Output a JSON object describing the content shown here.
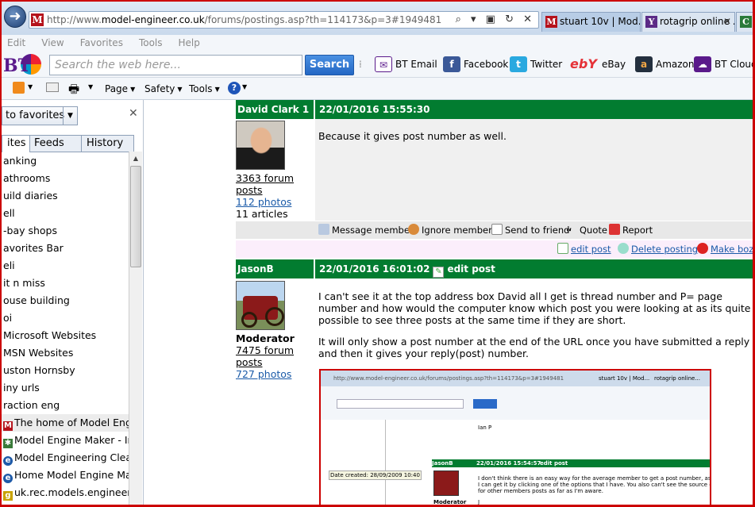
{
  "browser": {
    "address_prefix": "http://www.",
    "address_domain": "model-engineer.co.uk",
    "address_path": "/forums/postings.asp?th=114173&p=3#1949481",
    "address_tools": "⌕ ▾ ▣ ↻ ✕",
    "tabs": [
      {
        "label": "stuart 10v | Mod...",
        "icon": "M",
        "color": "#b5121b"
      },
      {
        "label": "rotagrip online ...",
        "icon": "Y",
        "color": "#5b2a86"
      },
      {
        "label": "C",
        "icon": "C",
        "color": "#2a7a3a"
      }
    ],
    "tab_close": "✕"
  },
  "menu": [
    "Edit",
    "View",
    "Favorites",
    "Tools",
    "Help"
  ],
  "bt_toolbar": {
    "logo": "BT",
    "search_placeholder": "Search the web here...",
    "search_button": "Search",
    "links": [
      {
        "label": "BT Email",
        "icon": "✉",
        "color": "#5a1a8b"
      },
      {
        "label": "Facebook",
        "icon": "f",
        "color": "#3b5998"
      },
      {
        "label": "Twitter",
        "icon": "t",
        "color": "#2aa9e0"
      },
      {
        "label": "eBay",
        "icon": "e",
        "color": "#e53238"
      },
      {
        "label": "Amazon",
        "icon": "a",
        "color": "#f3a847"
      },
      {
        "label": "BT Cloud",
        "icon": "☁",
        "color": "#5a1a8b"
      }
    ]
  },
  "command_bar": {
    "page": "Page",
    "safety": "Safety",
    "tools": "Tools",
    "help_icon": "?"
  },
  "favorites": {
    "add_button": "to favorites",
    "close": "✕",
    "tabs": [
      "ites",
      "Feeds",
      "History"
    ],
    "items": [
      {
        "label": "anking"
      },
      {
        "label": "athrooms"
      },
      {
        "label": "uild diaries"
      },
      {
        "label": "ell"
      },
      {
        "label": "-bay shops"
      },
      {
        "label": "avorites Bar"
      },
      {
        "label": "eli"
      },
      {
        "label": "it n miss"
      },
      {
        "label": "ouse building"
      },
      {
        "label": "oi"
      },
      {
        "label": "Microsoft Websites"
      },
      {
        "label": "MSN Websites"
      },
      {
        "label": "uston Hornsby"
      },
      {
        "label": "iny urls"
      },
      {
        "label": "raction eng"
      },
      {
        "label": "The home of Model Engi...",
        "icon": "M",
        "color": "#b5121b",
        "highlight": true
      },
      {
        "label": "Model Engine Maker - In...",
        "icon": "✱",
        "color": "#3a7a3a"
      },
      {
        "label": "Model Engineering Clear...",
        "icon": "e",
        "color": "#1e5aa8"
      },
      {
        "label": "Home Model Engine Ma...",
        "icon": "e",
        "color": "#1e5aa8"
      },
      {
        "label": "uk.rec.models.engineering",
        "icon": "g",
        "color": "#c8a200"
      }
    ]
  },
  "posts": [
    {
      "author": "David Clark 1",
      "datetime": "22/01/2016 15:55:30",
      "edit": "",
      "posts_count": "3363 forum posts",
      "photos": "112 photos",
      "articles": "11 articles",
      "role": "",
      "body": [
        "Because it gives post number as well."
      ],
      "actions": [
        "Message member",
        "Ignore member",
        "Send to friend",
        "Quote",
        "Report"
      ],
      "mod_actions": [
        "edit post",
        "Delete posting",
        "Make bozo"
      ]
    },
    {
      "author": "JasonB",
      "datetime": "22/01/2016 16:01:02",
      "edit": "edit post",
      "role": "Moderator",
      "posts_count": "7475 forum posts",
      "photos": "727 photos",
      "articles": "",
      "body": [
        "I can't see it at the top address box David all I get is thread number and P= page number and how would the computer know which post you were looking at as its quite possible to see three posts at the same time if they are short.",
        "It will only show a post number at the end of the URL once you have submitted a reply and then it gives your reply(post) number."
      ]
    }
  ],
  "embedded_shot": {
    "url": "http://www.model-engineer.co.uk/forums/postings.asp?th=114173&p=3#1949481",
    "tab1": "stuart 10v | Mod...",
    "tab2": "rotagrip online...",
    "author": "JasonB",
    "datetime": "22/01/2016 15:54:57",
    "edit": "edit post",
    "role": "Moderator",
    "sig": "Ian P",
    "tooltip": "Date created: 28/09/2009 10:40",
    "line1": "I don't think there is an easy way for the average member to get a post number, as a Mod",
    "line2": "I can get it by clicking one of the options that I have. You also can't see the source code",
    "line3": "for other members posts as far as I'm aware.",
    "line4": "J"
  }
}
